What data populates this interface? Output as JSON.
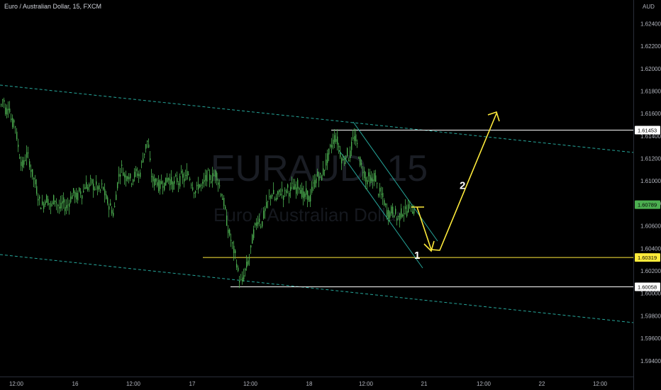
{
  "header": {
    "symbol_title": "Euro / Australian Dollar, 15, FXCM",
    "currency_label": "AUD"
  },
  "watermark": {
    "ticker": "EURAUD, 15",
    "name": "Euro / Australian Dollar"
  },
  "chart_data": {
    "type": "candlestick",
    "title": "Euro / Australian Dollar, 15, FXCM",
    "y_axis_unit": "AUD",
    "ylim": [
      1.5926,
      1.6256
    ],
    "y_ticks": [
      "1.62400",
      "1.62200",
      "1.62000",
      "1.61800",
      "1.61600",
      "1.61400",
      "1.61200",
      "1.61000",
      "1.60800",
      "1.60600",
      "1.60400",
      "1.60200",
      "1.60000",
      "1.59800",
      "1.59600",
      "1.59400"
    ],
    "x_ticks": [
      "12:00",
      "16",
      "12:00",
      "17",
      "12:00",
      "18",
      "12:00",
      "21",
      "12:00",
      "22",
      "12:00"
    ],
    "grid": false,
    "price_path": [
      [
        0,
        1.6165
      ],
      [
        4,
        1.6175
      ],
      [
        8,
        1.616
      ],
      [
        12,
        1.617
      ],
      [
        16,
        1.615
      ],
      [
        20,
        1.6155
      ],
      [
        24,
        1.6135
      ],
      [
        28,
        1.612
      ],
      [
        32,
        1.6112
      ],
      [
        36,
        1.6124
      ],
      [
        40,
        1.612
      ],
      [
        44,
        1.6108
      ],
      [
        48,
        1.61
      ],
      [
        52,
        1.609
      ],
      [
        56,
        1.608
      ],
      [
        60,
        1.6078
      ],
      [
        64,
        1.6085
      ],
      [
        68,
        1.6082
      ],
      [
        72,
        1.6076
      ],
      [
        76,
        1.6086
      ],
      [
        80,
        1.608
      ],
      [
        84,
        1.6074
      ],
      [
        88,
        1.6082
      ],
      [
        92,
        1.6076
      ],
      [
        96,
        1.608
      ],
      [
        100,
        1.6086
      ],
      [
        104,
        1.609
      ],
      [
        108,
        1.6084
      ],
      [
        112,
        1.6092
      ],
      [
        116,
        1.6088
      ],
      [
        120,
        1.6098
      ],
      [
        124,
        1.6093
      ],
      [
        128,
        1.61
      ],
      [
        132,
        1.6094
      ],
      [
        136,
        1.6096
      ],
      [
        140,
        1.609
      ],
      [
        144,
        1.6096
      ],
      [
        148,
        1.6086
      ],
      [
        152,
        1.608
      ],
      [
        156,
        1.6076
      ],
      [
        160,
        1.607
      ],
      [
        164,
        1.6094
      ],
      [
        168,
        1.6108
      ],
      [
        172,
        1.6112
      ],
      [
        176,
        1.6102
      ],
      [
        180,
        1.6108
      ],
      [
        184,
        1.61
      ],
      [
        188,
        1.6104
      ],
      [
        192,
        1.6108
      ],
      [
        196,
        1.6104
      ],
      [
        200,
        1.6118
      ],
      [
        204,
        1.6128
      ],
      [
        208,
        1.6138
      ],
      [
        212,
        1.6108
      ],
      [
        216,
        1.6098
      ],
      [
        220,
        1.6102
      ],
      [
        224,
        1.6094
      ],
      [
        228,
        1.61
      ],
      [
        232,
        1.6096
      ],
      [
        236,
        1.6104
      ],
      [
        240,
        1.61
      ],
      [
        244,
        1.6096
      ],
      [
        248,
        1.6102
      ],
      [
        252,
        1.6098
      ],
      [
        256,
        1.6106
      ],
      [
        260,
        1.61
      ],
      [
        264,
        1.6108
      ],
      [
        268,
        1.6102
      ],
      [
        272,
        1.6094
      ],
      [
        276,
        1.609
      ],
      [
        280,
        1.6098
      ],
      [
        284,
        1.6094
      ],
      [
        288,
        1.61
      ],
      [
        292,
        1.6106
      ],
      [
        296,
        1.6102
      ],
      [
        300,
        1.6104
      ],
      [
        304,
        1.6108
      ],
      [
        308,
        1.6098
      ],
      [
        312,
        1.6088
      ],
      [
        316,
        1.6078
      ],
      [
        320,
        1.606
      ],
      [
        324,
        1.605
      ],
      [
        328,
        1.604
      ],
      [
        332,
        1.6032
      ],
      [
        336,
        1.6015
      ],
      [
        340,
        1.6008
      ],
      [
        344,
        1.6018
      ],
      [
        348,
        1.6026
      ],
      [
        352,
        1.6034
      ],
      [
        356,
        1.6052
      ],
      [
        360,
        1.606
      ],
      [
        364,
        1.6068
      ],
      [
        368,
        1.606
      ],
      [
        372,
        1.6072
      ],
      [
        376,
        1.6078
      ],
      [
        380,
        1.6086
      ],
      [
        384,
        1.609
      ],
      [
        388,
        1.6082
      ],
      [
        392,
        1.6088
      ],
      [
        396,
        1.6092
      ],
      [
        400,
        1.6086
      ],
      [
        404,
        1.6094
      ],
      [
        408,
        1.609
      ],
      [
        412,
        1.6096
      ],
      [
        416,
        1.6092
      ],
      [
        420,
        1.6098
      ],
      [
        424,
        1.6092
      ],
      [
        428,
        1.6084
      ],
      [
        432,
        1.609
      ],
      [
        436,
        1.6082
      ],
      [
        440,
        1.6094
      ],
      [
        444,
        1.61
      ],
      [
        448,
        1.6106
      ],
      [
        452,
        1.6102
      ],
      [
        456,
        1.611
      ],
      [
        460,
        1.6118
      ],
      [
        464,
        1.6126
      ],
      [
        468,
        1.6134
      ],
      [
        472,
        1.614
      ],
      [
        476,
        1.6134
      ],
      [
        480,
        1.6122
      ],
      [
        484,
        1.6116
      ],
      [
        488,
        1.6126
      ],
      [
        492,
        1.612
      ],
      [
        496,
        1.6134
      ],
      [
        500,
        1.614
      ],
      [
        504,
        1.6128
      ],
      [
        508,
        1.6114
      ],
      [
        512,
        1.611
      ],
      [
        516,
        1.61
      ],
      [
        520,
        1.6104
      ],
      [
        524,
        1.6098
      ],
      [
        528,
        1.6106
      ],
      [
        532,
        1.6092
      ],
      [
        536,
        1.6088
      ],
      [
        540,
        1.6084
      ],
      [
        544,
        1.6074
      ],
      [
        548,
        1.607
      ],
      [
        552,
        1.6074
      ],
      [
        556,
        1.6072
      ],
      [
        560,
        1.6066
      ],
      [
        564,
        1.607
      ],
      [
        568,
        1.6074
      ],
      [
        572,
        1.6072
      ],
      [
        576,
        1.6078
      ],
      [
        580,
        1.6076
      ],
      [
        584,
        1.6074
      ]
    ],
    "price_labels": [
      {
        "value": 1.61453,
        "text": "1.61453",
        "style": "white"
      },
      {
        "value": 1.60789,
        "text": "1.60789",
        "style": "green"
      },
      {
        "value": 1.60319,
        "text": "1.60319",
        "style": "yellow"
      },
      {
        "value": 1.60058,
        "text": "1.60058",
        "style": "white"
      }
    ],
    "annotations": [
      {
        "text": "1",
        "label_position": [
          584,
          1.6034
        ]
      },
      {
        "text": "2",
        "label_position": [
          648,
          1.6096
        ]
      }
    ],
    "colors": {
      "background": "#000000",
      "candle": "#4caf50",
      "channel_dashed": "#26a69a",
      "drawing_yellow": "#ffeb3b",
      "level_white": "#ffffff",
      "current_price_badge": "#4caf50",
      "yellow_level_badge": "#ffeb3b"
    }
  }
}
